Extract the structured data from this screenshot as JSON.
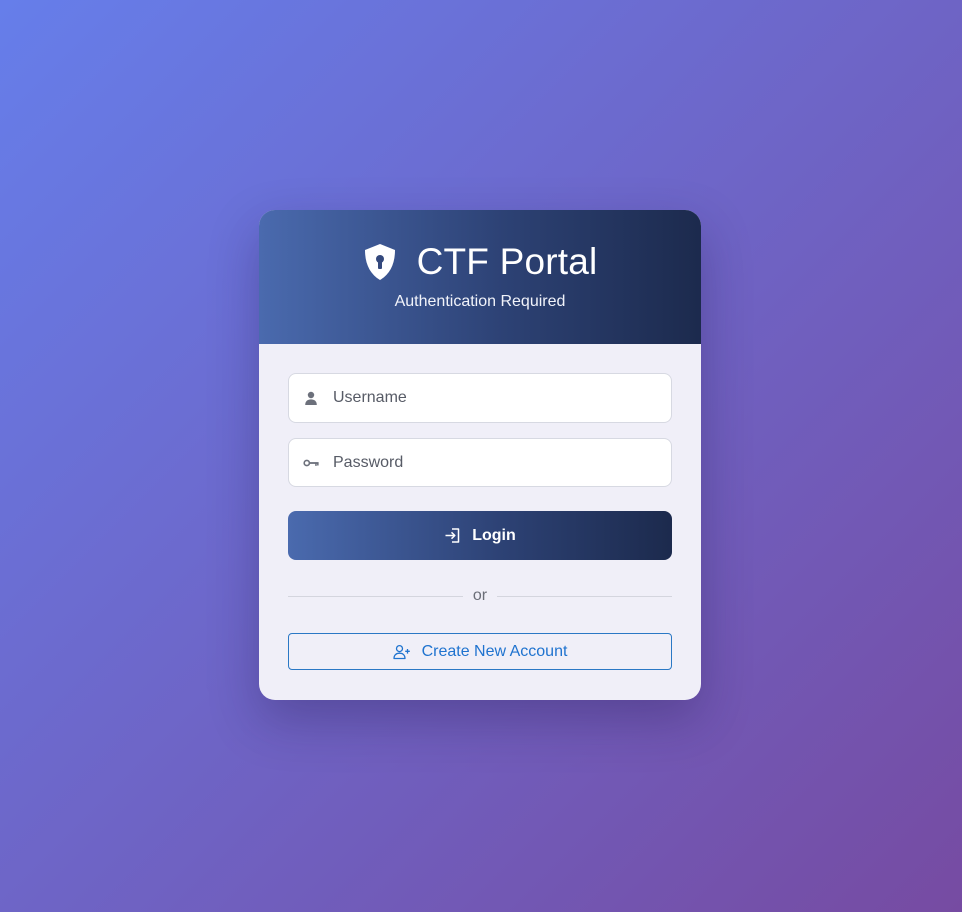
{
  "header": {
    "title": "CTF Portal",
    "subtitle": "Authentication Required",
    "icon": "shield-keyhole-icon"
  },
  "form": {
    "username": {
      "placeholder": "Username",
      "value": "",
      "icon": "user-icon"
    },
    "password": {
      "placeholder": "Password",
      "value": "",
      "icon": "key-icon"
    },
    "login_label": "Login",
    "login_icon": "sign-in-icon",
    "divider_text": "or",
    "create_label": "Create New Account",
    "create_icon": "user-plus-icon"
  },
  "colors": {
    "background_start": "#667eea",
    "background_end": "#764ba2",
    "header_start": "#4a6aae",
    "header_end": "#1c2a4d",
    "link_blue": "#1f73cf"
  }
}
